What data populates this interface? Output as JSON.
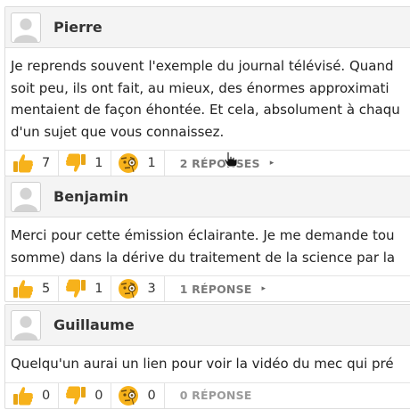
{
  "comments": [
    {
      "author": "Pierre",
      "lines": [
        "Je reprends souvent l'exemple du journal télévisé. Quand",
        "soit peu, ils ont fait, au mieux, des énormes approximati",
        "mentaient de façon éhontée. Et cela, absolument à chaqu",
        "d'un sujet que vous connaissez."
      ],
      "reactions": {
        "thumbs_up": "7",
        "thumbs_down": "1",
        "monocle": "1"
      },
      "replies_label": "2 RÉPONSES",
      "replies_arrow": "▸"
    },
    {
      "author": "Benjamin",
      "lines": [
        "Merci pour cette émission éclairante. Je me demande tou",
        "somme) dans la dérive du traitement de la science par la"
      ],
      "reactions": {
        "thumbs_up": "5",
        "thumbs_down": "1",
        "monocle": "3"
      },
      "replies_label": "1 RÉPONSE",
      "replies_arrow": "▸"
    },
    {
      "author": "Guillaume",
      "lines": [
        "Quelqu'un aurai un lien pour voir la vidéo du mec qui pré"
      ],
      "reactions": {
        "thumbs_up": "0",
        "thumbs_down": "0",
        "monocle": "0"
      },
      "replies_label": "0 RÉPONSE",
      "replies_arrow": ""
    }
  ],
  "colors": {
    "emoji_yellow": "#f7b21b",
    "border": "#dcdcdc",
    "header_bg": "#f4f4f4"
  },
  "icons": {
    "thumbs_up": "thumbs-up-icon",
    "thumbs_down": "thumbs-down-icon",
    "monocle": "monocle-face-icon",
    "avatar": "user-avatar-icon"
  }
}
